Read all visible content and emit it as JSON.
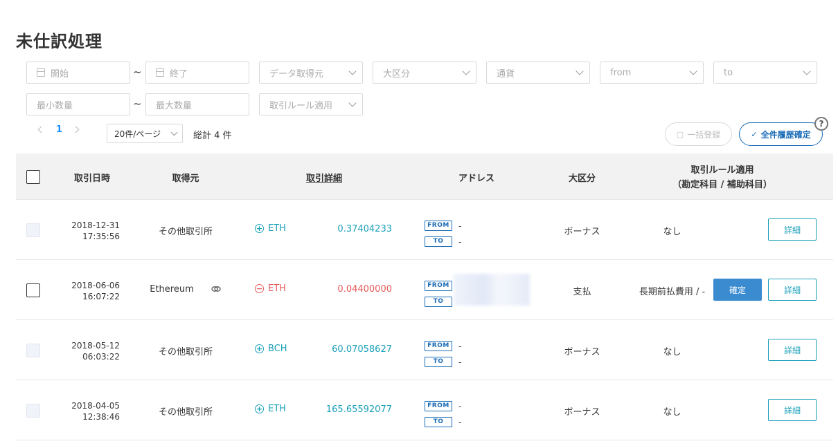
{
  "page": {
    "title": "未仕訳処理"
  },
  "filters": {
    "start_placeholder": "開始",
    "end_placeholder": "終了",
    "source_placeholder": "データ取得元",
    "category_placeholder": "大区分",
    "currency_placeholder": "通貨",
    "from_placeholder": "from",
    "to_placeholder": "to",
    "min_qty_placeholder": "最小数量",
    "max_qty_placeholder": "最大数量",
    "rule_placeholder": "取引ルール適用",
    "tilde": "~"
  },
  "pagination": {
    "current_page": "1",
    "page_size": "20件/ページ",
    "total": "総計 4 件"
  },
  "actions": {
    "bulk_register": "一括登録",
    "confirm_all": "全件履歴確定",
    "help": "?"
  },
  "table": {
    "headers": {
      "date": "取引日時",
      "source": "取得元",
      "detail": "取引詳細",
      "address": "アドレス",
      "category": "大区分",
      "rule_line1": "取引ルール適用",
      "rule_line2": "（勘定科目 / 補助科目）"
    },
    "from_tag": "FROM",
    "to_tag": "TO",
    "detail_button": "詳細",
    "confirm_button": "確定",
    "rows": [
      {
        "date": "2018-12-31",
        "time": "17:35:56",
        "source": "その他取引所",
        "direction": "+",
        "currency": "ETH",
        "amount": "0.37404233",
        "from": "-",
        "to": "-",
        "category": "ボーナス",
        "rule": "なし"
      },
      {
        "date": "2018-06-06",
        "time": "16:07:22",
        "source": "Ethereum",
        "direction": "−",
        "currency": "ETH",
        "amount": "0.04400000",
        "from": "",
        "to": "",
        "category": "支払",
        "rule": "長期前払費用 / -"
      },
      {
        "date": "2018-05-12",
        "time": "06:03:22",
        "source": "その他取引所",
        "direction": "+",
        "currency": "BCH",
        "amount": "60.07058627",
        "from": "-",
        "to": "-",
        "category": "ボーナス",
        "rule": "なし"
      },
      {
        "date": "2018-04-05",
        "time": "12:38:46",
        "source": "その他取引所",
        "direction": "+",
        "currency": "ETH",
        "amount": "165.65592077",
        "from": "-",
        "to": "-",
        "category": "ボーナス",
        "rule": "なし"
      }
    ]
  },
  "colors": {
    "inflow": "#19a0b8",
    "outflow": "#e55a5a",
    "accent": "#1a6bb6",
    "confirm_bg": "#3b8bd0"
  }
}
